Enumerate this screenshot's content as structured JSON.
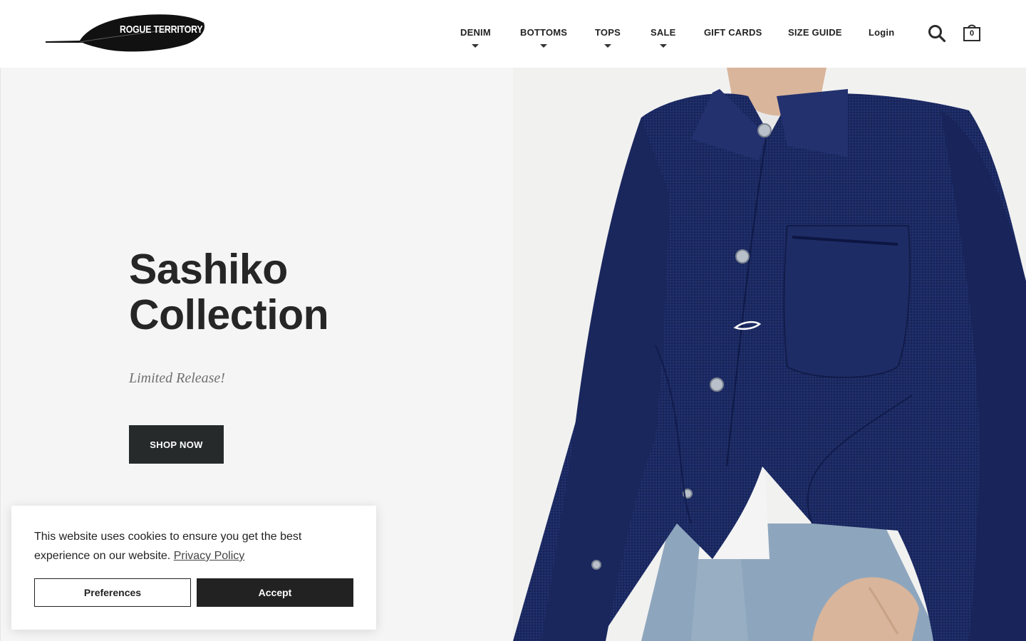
{
  "brand": {
    "logo_text": "ROGUE TERRITORY"
  },
  "nav": {
    "items": [
      {
        "label": "DENIM",
        "has_dropdown": true
      },
      {
        "label": "BOTTOMS",
        "has_dropdown": true
      },
      {
        "label": "TOPS",
        "has_dropdown": true
      },
      {
        "label": "SALE",
        "has_dropdown": true
      },
      {
        "label": "GIFT CARDS",
        "has_dropdown": false
      },
      {
        "label": "SIZE GUIDE",
        "has_dropdown": false
      }
    ],
    "login_label": "Login",
    "search_icon": "search-icon",
    "cart_icon": "shopping-bag-icon",
    "cart_count": "0"
  },
  "hero": {
    "title_line1": "Sashiko",
    "title_line2": "Collection",
    "subtitle": "Limited Release!",
    "cta_label": "SHOP NOW",
    "image_subject": "person wearing indigo sashiko chore jacket over white t-shirt and light-wash jeans",
    "colors": {
      "panel_bg": "#f5f5f5",
      "cta_bg": "#262a2b",
      "jacket_color": "#1c2a63"
    }
  },
  "cookie_banner": {
    "text": "This website uses cookies to ensure you get the best experience on our website.",
    "link_label": "Privacy Policy",
    "preferences_label": "Preferences",
    "accept_label": "Accept"
  }
}
